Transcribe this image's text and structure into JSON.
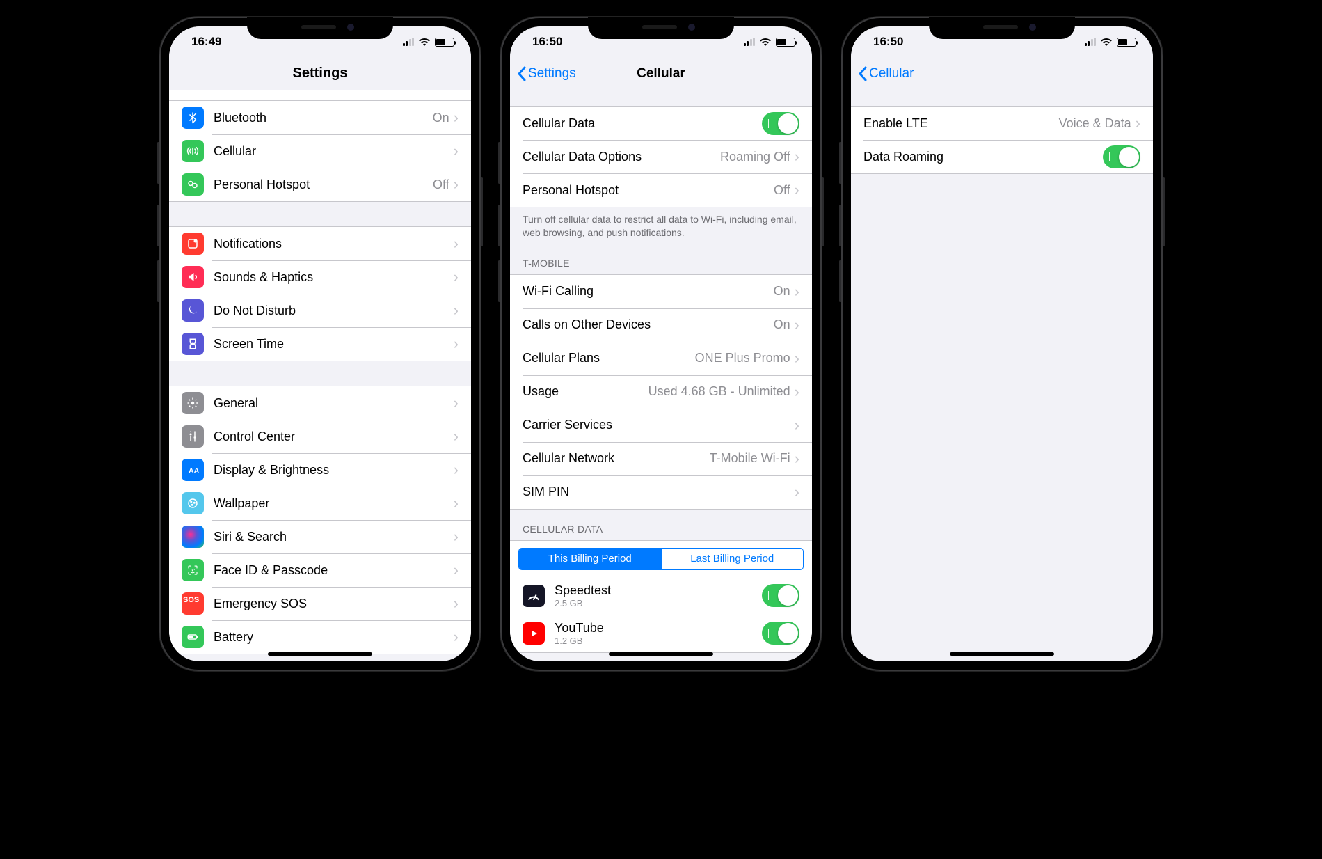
{
  "status": {
    "time1": "16:49",
    "time2": "16:50",
    "time3": "16:50"
  },
  "screen1": {
    "title": "Settings",
    "rows1": [
      {
        "icon": "bluetooth",
        "color": "#007aff",
        "label": "Bluetooth",
        "detail": "On"
      },
      {
        "icon": "cellular",
        "color": "#34c759",
        "label": "Cellular",
        "detail": ""
      },
      {
        "icon": "hotspot",
        "color": "#34c759",
        "label": "Personal Hotspot",
        "detail": "Off"
      }
    ],
    "rows2": [
      {
        "icon": "notifications",
        "color": "#ff3b30",
        "label": "Notifications"
      },
      {
        "icon": "sounds",
        "color": "#ff2d55",
        "label": "Sounds & Haptics"
      },
      {
        "icon": "dnd",
        "color": "#5856d6",
        "label": "Do Not Disturb"
      },
      {
        "icon": "screentime",
        "color": "#5856d6",
        "label": "Screen Time"
      }
    ],
    "rows3": [
      {
        "icon": "general",
        "color": "#8e8e93",
        "label": "General"
      },
      {
        "icon": "controlcenter",
        "color": "#8e8e93",
        "label": "Control Center"
      },
      {
        "icon": "display",
        "color": "#007aff",
        "label": "Display & Brightness"
      },
      {
        "icon": "wallpaper",
        "color": "#54c7ec",
        "label": "Wallpaper"
      },
      {
        "icon": "siri",
        "color": "#000",
        "label": "Siri & Search"
      },
      {
        "icon": "faceid",
        "color": "#34c759",
        "label": "Face ID & Passcode"
      },
      {
        "icon": "sos",
        "color": "#ff3b30",
        "label": "Emergency SOS"
      },
      {
        "icon": "battery",
        "color": "#34c759",
        "label": "Battery"
      }
    ]
  },
  "screen2": {
    "back": "Settings",
    "title": "Cellular",
    "rows1": [
      {
        "label": "Cellular Data",
        "toggle": true
      },
      {
        "label": "Cellular Data Options",
        "detail": "Roaming Off"
      },
      {
        "label": "Personal Hotspot",
        "detail": "Off"
      }
    ],
    "footer1": "Turn off cellular data to restrict all data to Wi-Fi, including email, web browsing, and push notifications.",
    "header2": "T-MOBILE",
    "rows2": [
      {
        "label": "Wi-Fi Calling",
        "detail": "On"
      },
      {
        "label": "Calls on Other Devices",
        "detail": "On"
      },
      {
        "label": "Cellular Plans",
        "detail": "ONE Plus Promo"
      },
      {
        "label": "Usage",
        "detail": "Used 4.68 GB - Unlimited"
      },
      {
        "label": "Carrier Services",
        "detail": ""
      },
      {
        "label": "Cellular Network",
        "detail": "T-Mobile Wi-Fi"
      },
      {
        "label": "SIM PIN",
        "detail": ""
      }
    ],
    "header3": "CELLULAR DATA",
    "seg1": "This Billing Period",
    "seg2": "Last Billing Period",
    "apps": [
      {
        "name": "Speedtest",
        "sub": "2.5 GB",
        "icon": "speedtest"
      },
      {
        "name": "YouTube",
        "sub": "1.2 GB",
        "icon": "youtube"
      }
    ]
  },
  "screen3": {
    "back": "Cellular",
    "rows": [
      {
        "label": "Enable LTE",
        "detail": "Voice & Data"
      },
      {
        "label": "Data Roaming",
        "toggle": true
      }
    ]
  }
}
